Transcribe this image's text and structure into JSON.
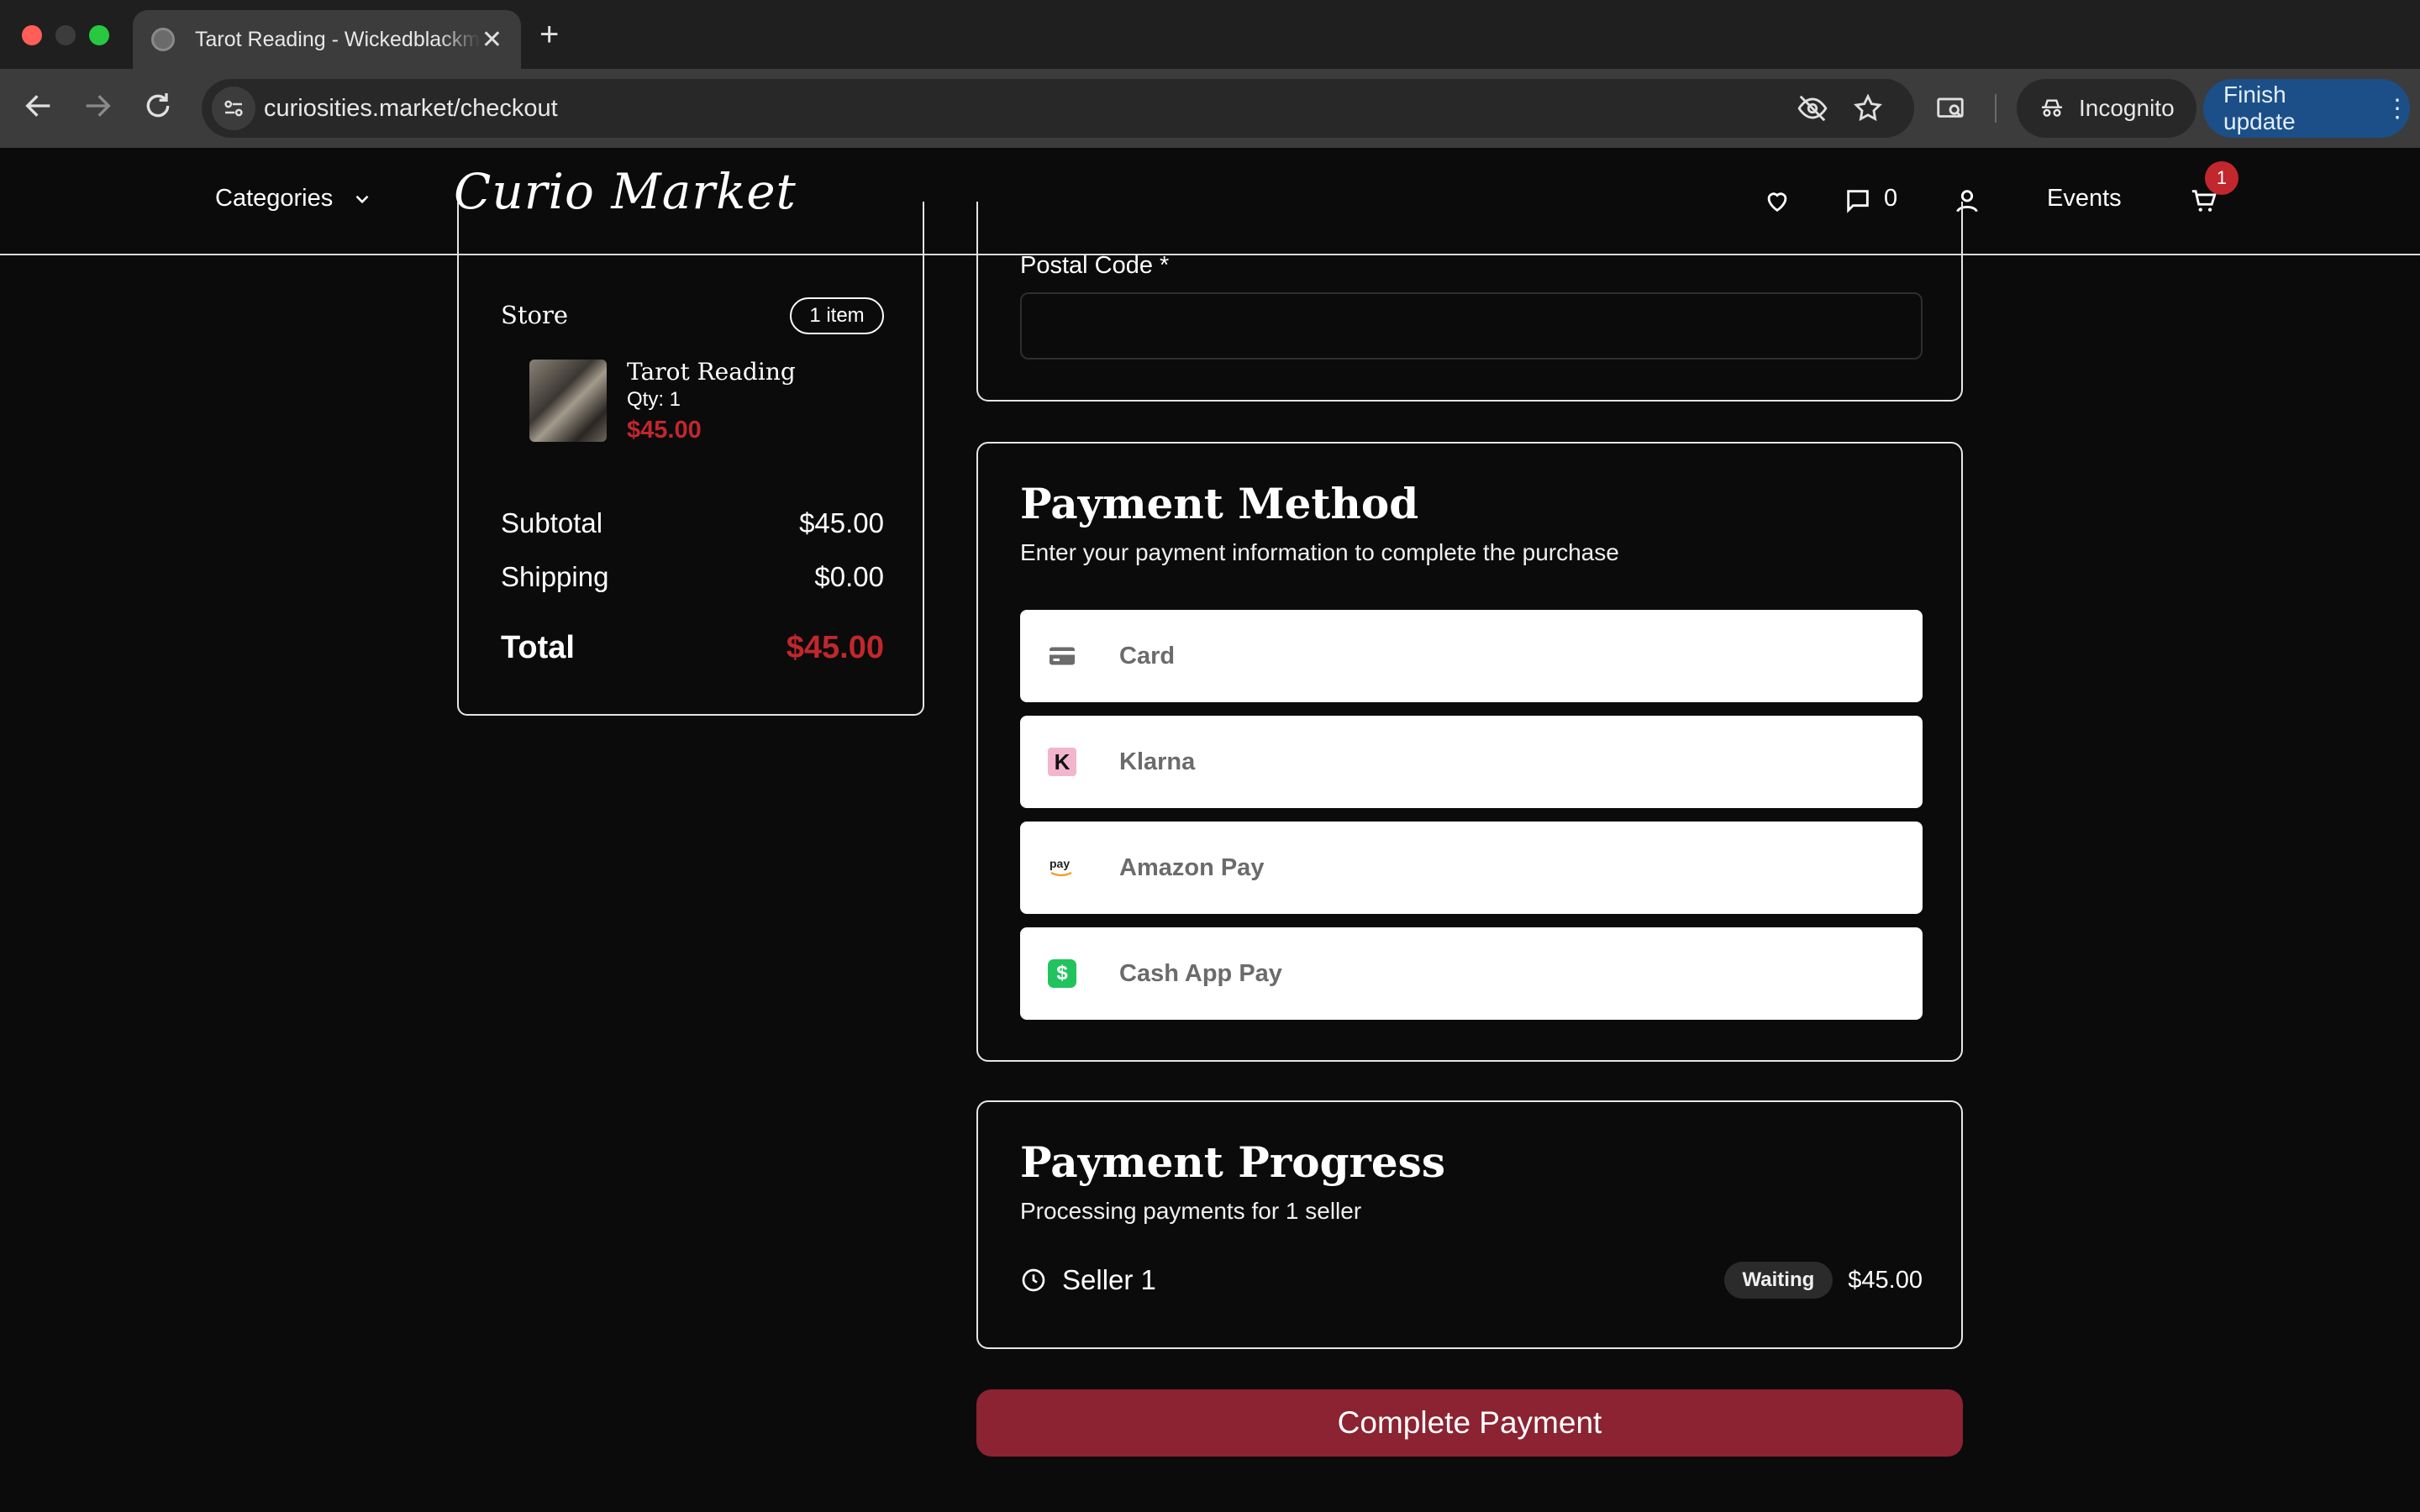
{
  "browser": {
    "tab_title": "Tarot Reading - Wickedblackmagic",
    "url": "curiosities.market/checkout",
    "incognito_label": "Incognito",
    "finish_update_label": "Finish update"
  },
  "header": {
    "categories_label": "Categories",
    "logo_first": "Curio",
    "logo_second": "Market",
    "message_count": "0",
    "events_label": "Events",
    "cart_count": "1"
  },
  "summary": {
    "store_label": "Store",
    "items_count": "1 item",
    "item": {
      "title": "Tarot Reading",
      "qty": "Qty: 1",
      "price": "$45.00"
    },
    "subtotal_label": "Subtotal",
    "subtotal_value": "$45.00",
    "shipping_label": "Shipping",
    "shipping_value": "$0.00",
    "total_label": "Total",
    "total_value": "$45.00"
  },
  "address": {
    "postal_label": "Postal Code *",
    "postal_value": ""
  },
  "payment_method": {
    "title": "Payment Method",
    "subtitle": "Enter your payment information to complete the purchase",
    "options": [
      {
        "label": "Card",
        "icon": "credit-card-icon"
      },
      {
        "label": "Klarna",
        "icon": "klarna-icon"
      },
      {
        "label": "Amazon Pay",
        "icon": "amazon-pay-icon"
      },
      {
        "label": "Cash App Pay",
        "icon": "cash-app-icon"
      }
    ]
  },
  "payment_progress": {
    "title": "Payment Progress",
    "subtitle": "Processing payments for 1 seller",
    "seller_name": "Seller 1",
    "status": "Waiting",
    "amount": "$45.00"
  },
  "complete_button_label": "Complete Payment",
  "colors": {
    "accent_red": "#c1272d",
    "button_red": "#8b2332",
    "background": "#0b0b0b",
    "update_blue": "#1c4f87"
  }
}
